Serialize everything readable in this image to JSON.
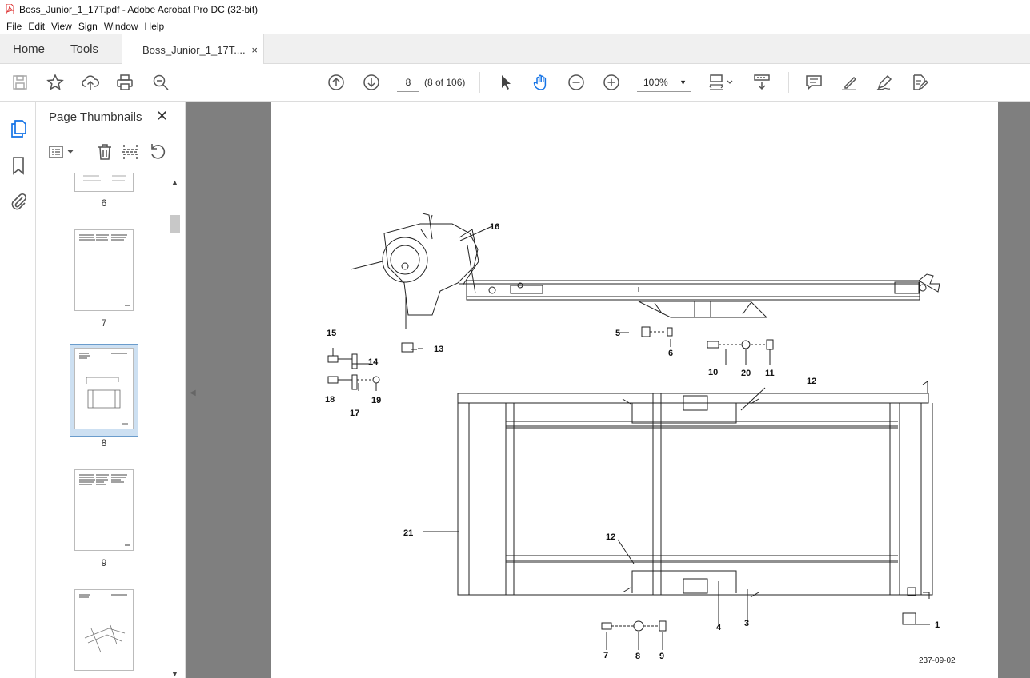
{
  "window": {
    "title": "Boss_Junior_1_17T.pdf - Adobe Acrobat Pro DC (32-bit)"
  },
  "menu": [
    "File",
    "Edit",
    "View",
    "Sign",
    "Window",
    "Help"
  ],
  "tabs": {
    "home": "Home",
    "tools": "Tools",
    "doc": "Boss_Junior_1_17T....",
    "doc_close": "×"
  },
  "toolbar": {
    "icons": [
      "save-icon",
      "bookmark-star-icon",
      "upload-icon",
      "print-icon",
      "zoom-search-icon",
      "page-up-icon",
      "page-down-icon",
      "select-arrow-icon",
      "hand-icon",
      "zoom-out-icon",
      "zoom-in-icon",
      "fit-page-icon",
      "scroll-mode-icon",
      "comment-icon",
      "highlight-icon",
      "sign-icon",
      "edit-pdf-icon"
    ],
    "page_current": "8",
    "page_of": "(8 of 106)",
    "zoom": "100%"
  },
  "panel": {
    "title": "Page Thumbnails",
    "close": "✕",
    "thumbnails": [
      {
        "label": "6"
      },
      {
        "label": "7"
      },
      {
        "label": "8",
        "selected": true
      },
      {
        "label": "9"
      },
      {
        "label": ""
      }
    ]
  },
  "document": {
    "callouts": [
      "16",
      "13",
      "15",
      "14",
      "18",
      "17",
      "19",
      "5",
      "6",
      "10",
      "20",
      "11",
      "12",
      "21",
      "12",
      "4",
      "3",
      "1",
      "7",
      "8",
      "9"
    ],
    "doc_ref": "237-09-02"
  },
  "colors": {
    "accent": "#1473e6",
    "viewer_bg": "#7f7f7f",
    "selected_thumb": "#cde0f2"
  }
}
